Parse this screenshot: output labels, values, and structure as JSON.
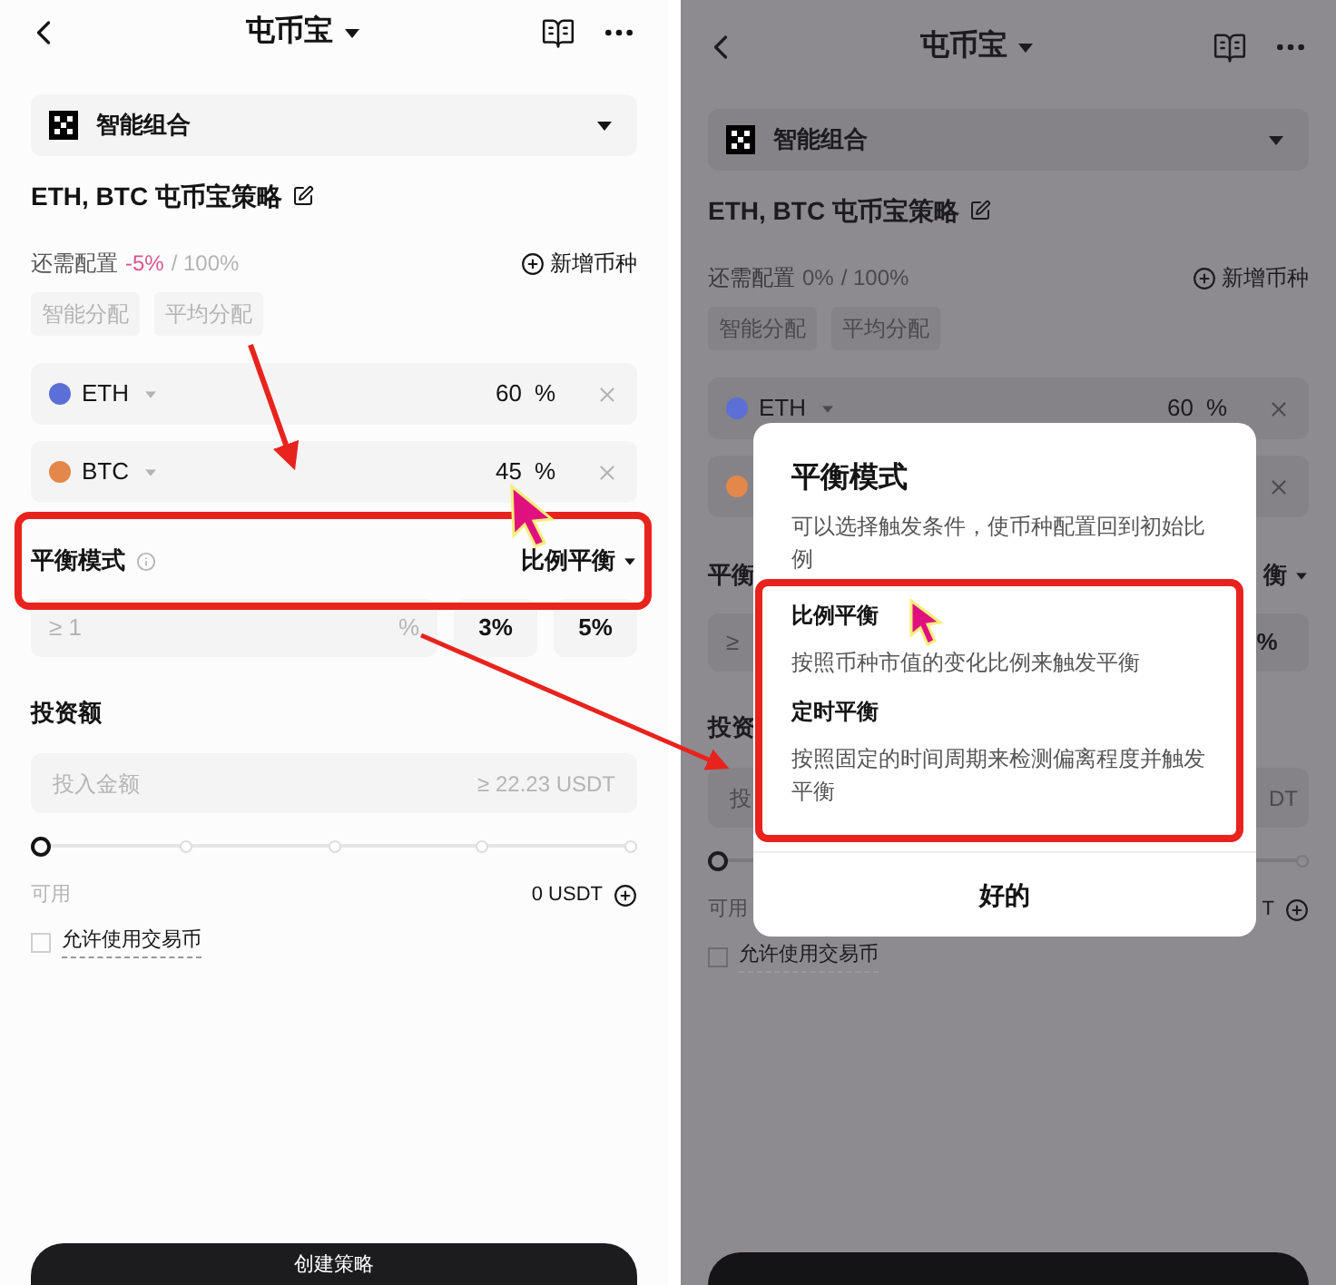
{
  "screens": [
    {
      "dimmed": false,
      "header": {
        "title": "屯币宝"
      },
      "product": {
        "name": "智能组合"
      },
      "strategy_title": "ETH, BTC 屯币宝策略",
      "allocation": {
        "label": "还需配置",
        "remaining": "-5%",
        "warning": true,
        "total": "/ 100%",
        "add_coin": "新增币种"
      },
      "alloc_buttons": [
        "智能分配",
        "平均分配"
      ],
      "coins": [
        {
          "symbol": "ETH",
          "percent": "60",
          "unit": "%",
          "color": "#5b6fd6"
        },
        {
          "symbol": "BTC",
          "percent": "45",
          "unit": "%",
          "color": "#e3884a"
        }
      ],
      "balance": {
        "label": "平衡模式",
        "info": true,
        "value": "比例平衡"
      },
      "threshold": {
        "placeholder": "≥ 1",
        "unit": "%",
        "presets": [
          "3%",
          "5%"
        ]
      },
      "invest": {
        "label": "投资额",
        "placeholder": "投入金额",
        "minimum": "≥ 22.23 USDT"
      },
      "slider": {
        "level": 0
      },
      "available": {
        "label": "可用",
        "amount": "0 USDT"
      },
      "checkbox": {
        "label": "允许使用交易币",
        "checked": false
      },
      "create_button": {
        "label": "创建策略"
      }
    },
    {
      "dimmed": true,
      "header": {
        "title": "屯币宝"
      },
      "product": {
        "name": "智能组合"
      },
      "strategy_title": "ETH, BTC 屯币宝策略",
      "allocation": {
        "label": "还需配置",
        "remaining": "0%",
        "warning": false,
        "total": "/ 100%",
        "add_coin": "新增币种"
      },
      "alloc_buttons": [
        "智能分配",
        "平均分配"
      ],
      "coins": [
        {
          "symbol": "ETH",
          "percent": "60",
          "unit": "%",
          "color": "#5b6fd6"
        },
        {
          "color": "#e3884a"
        }
      ],
      "balance": {
        "label": "平衡",
        "value": "衡"
      },
      "threshold": {
        "placeholder": "≥",
        "presets": [
          "%"
        ]
      },
      "invest": {
        "label": "投资",
        "placeholder": "投",
        "minimum": "DT"
      },
      "slider": {
        "level": 0
      },
      "available": {
        "label": "可用",
        "amount": "T"
      },
      "checkbox": {
        "label": "允许使用交易币",
        "checked": false
      },
      "dialog": {
        "title": "平衡模式",
        "description": "可以选择触发条件，使币种配置回到初始比例",
        "options": [
          {
            "title": "比例平衡",
            "description": "按照币种市值的变化比例来触发平衡"
          },
          {
            "title": "定时平衡",
            "description": "按照固定的时间周期来检测偏离程度并触发平衡"
          }
        ],
        "confirm": "好的"
      }
    }
  ]
}
